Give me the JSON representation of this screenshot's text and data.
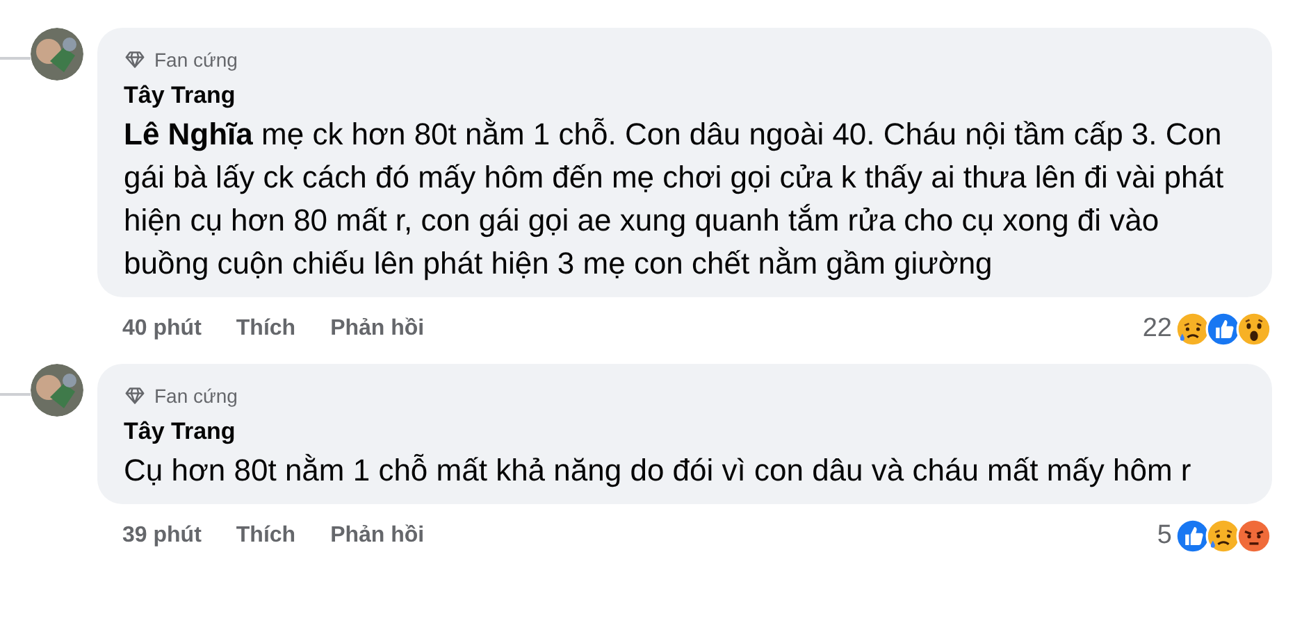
{
  "comments": [
    {
      "badge": "Fan cứng",
      "author": "Tây Trang",
      "text": "**Lê Nghĩa** mẹ ck hơn 80t nằm 1 chỗ. Con dâu ngoài 40. Cháu nội tầm cấp 3. Con gái bà lấy ck cách đó mấy hôm đến mẹ chơi gọi cửa k thấy ai thưa lên đi vài phát hiện cụ hơn 80 mất r, con gái gọi ae xung quanh tắm rửa cho cụ xong đi vào buồng cuộn chiếu lên phát hiện 3 mẹ con chết nằm gầm giường",
      "time": "40 phút",
      "actions": [
        "Thích",
        "Phản hồi"
      ],
      "reaction_count": "22",
      "reactions": [
        {
          "kind": "sad"
        },
        {
          "kind": "like"
        },
        {
          "kind": "wow"
        }
      ]
    },
    {
      "badge": "Fan cứng",
      "author": "Tây Trang",
      "text": "Cụ hơn 80t nằm 1 chỗ mất khả năng do đói vì con dâu và cháu mất mấy hôm r",
      "time": "39 phút",
      "actions": [
        "Thích",
        "Phản hồi"
      ],
      "reaction_count": "5",
      "reactions": [
        {
          "kind": "like"
        },
        {
          "kind": "sad"
        },
        {
          "kind": "angry"
        }
      ]
    }
  ]
}
